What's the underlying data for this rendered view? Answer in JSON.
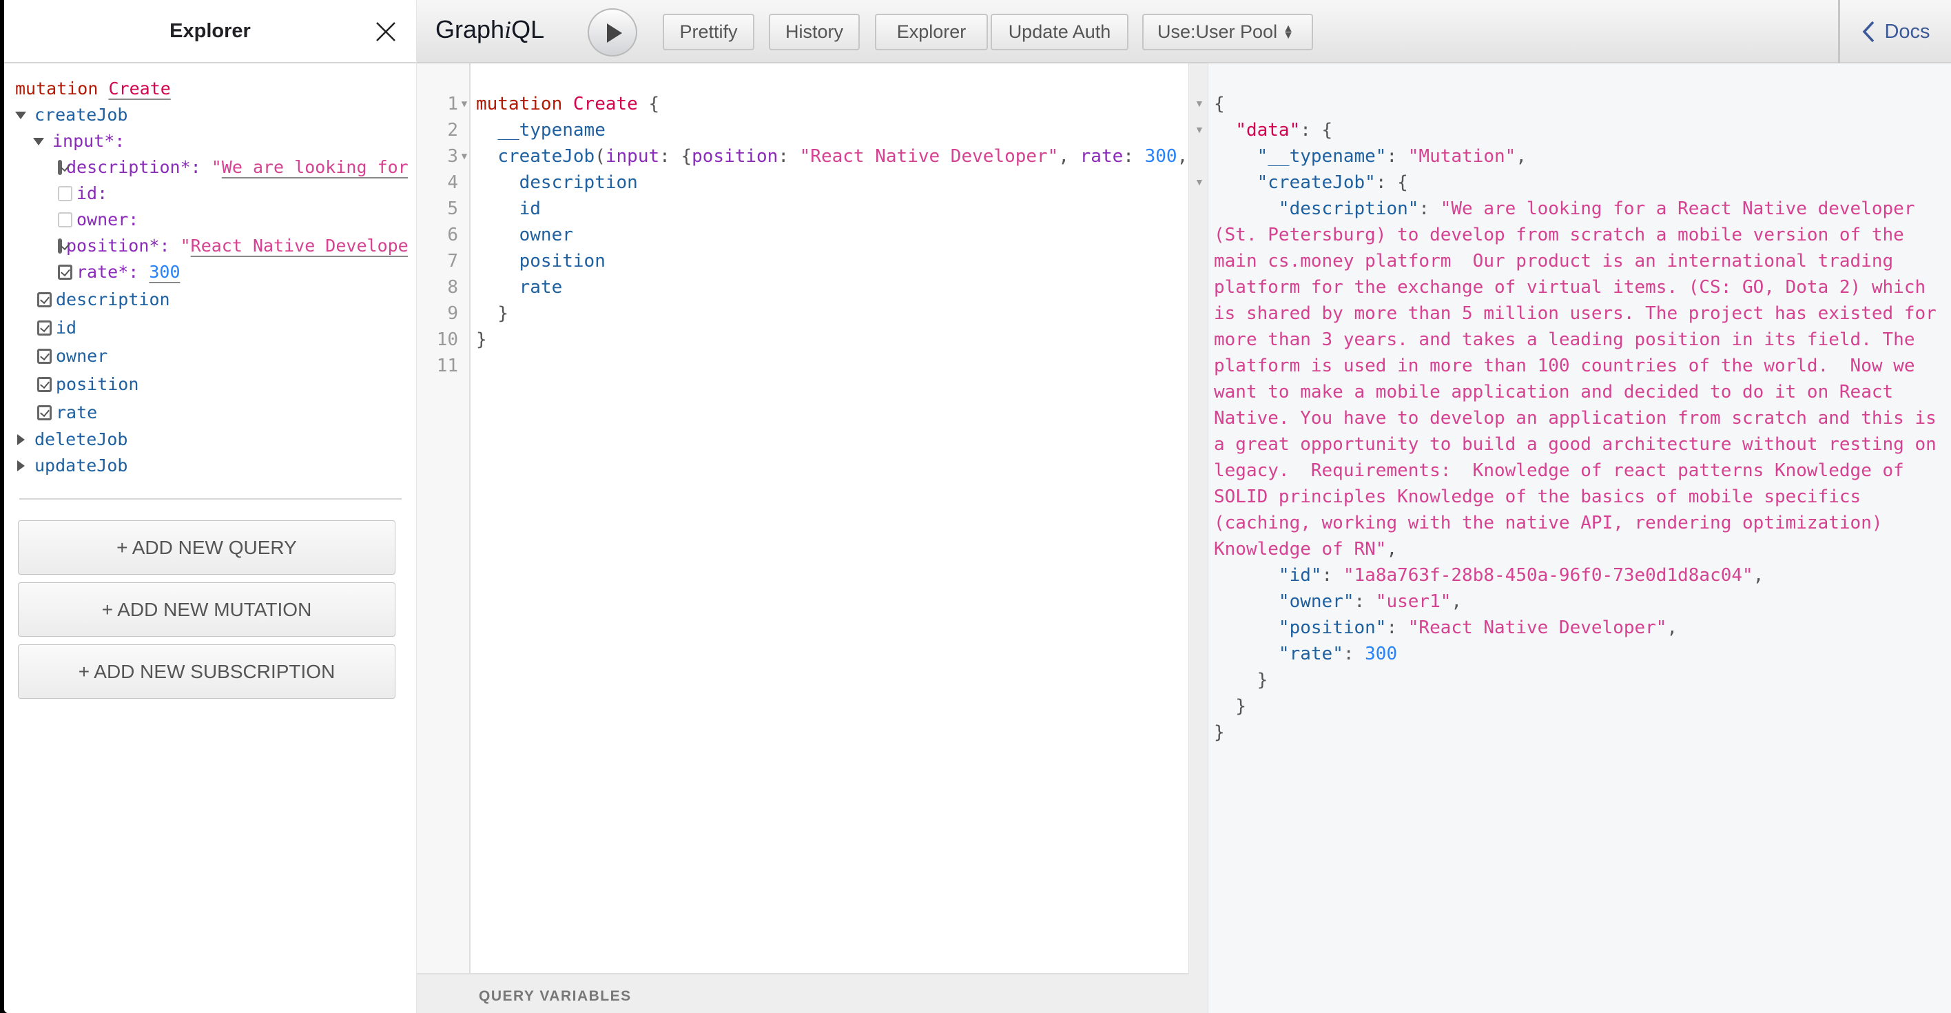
{
  "explorer": {
    "title": "Explorer",
    "operation": {
      "keyword": "mutation",
      "name": "Create"
    },
    "tree": {
      "createJob": {
        "label": "createJob",
        "input": {
          "label": "input*:",
          "fields": [
            {
              "label": "description*:",
              "checked": true,
              "value_prefix": "\"",
              "value": "We are looking for"
            },
            {
              "label": "id:",
              "checked": false
            },
            {
              "label": "owner:",
              "checked": false
            },
            {
              "label": "position*:",
              "checked": true,
              "value_prefix": "\"",
              "value": "React Native Develope"
            },
            {
              "label": "rate*:",
              "checked": true,
              "value": "300"
            }
          ]
        },
        "selections": [
          {
            "label": "description",
            "checked": true
          },
          {
            "label": "id",
            "checked": true
          },
          {
            "label": "owner",
            "checked": true
          },
          {
            "label": "position",
            "checked": true
          },
          {
            "label": "rate",
            "checked": true
          }
        ]
      },
      "deleteJob": {
        "label": "deleteJob"
      },
      "updateJob": {
        "label": "updateJob"
      }
    },
    "buttons": {
      "add_query": "+ ADD NEW QUERY",
      "add_mutation": "+ ADD NEW MUTATION",
      "add_subscription": "+ ADD NEW SUBSCRIPTION"
    }
  },
  "toolbar": {
    "logo_prefix": "Graph",
    "logo_italic": "i",
    "logo_suffix": "QL",
    "prettify": "Prettify",
    "history": "History",
    "explorer": "Explorer",
    "update_auth": "Update Auth",
    "auth_mode": "Use:User Pool",
    "docs": "Docs"
  },
  "editor": {
    "line_numbers": [
      "1",
      "2",
      "3",
      "4",
      "5",
      "6",
      "7",
      "8",
      "9",
      "10",
      "11"
    ],
    "lines": {
      "l1": {
        "kw": "mutation",
        "name": "Create",
        "brace": "{"
      },
      "l2": {
        "field": "__typename"
      },
      "l3": {
        "field": "createJob",
        "open": "(",
        "arg": "input",
        "colon": ": ",
        "brace": "{",
        "arg2": "position",
        "colon2": ": ",
        "str": "\"React Native Developer\"",
        "comma": ", ",
        "arg3": "rate",
        "colon3": ": ",
        "num": "300",
        "comma2": ","
      },
      "l4": {
        "field": "description"
      },
      "l5": {
        "field": "id"
      },
      "l6": {
        "field": "owner"
      },
      "l7": {
        "field": "position"
      },
      "l8": {
        "field": "rate"
      },
      "l9": {
        "brace": "}"
      },
      "l10": {
        "brace": "}"
      }
    },
    "variables_label": "QUERY VARIABLES"
  },
  "result": {
    "typename_key": "\"__typename\"",
    "typename_value": "\"Mutation\"",
    "data_key": "\"data\"",
    "createJob_key": "\"createJob\"",
    "description_key": "\"description\"",
    "description_value": "\"We are looking for a React Native developer (St. Petersburg) to develop from scratch a mobile version of the main cs.money platform  Our product is an international trading platform for the exchange of virtual items. (CS: GO, Dota 2) which is shared by more than 5 million users. The project has existed for more than 3 years. and takes a leading position in its field. The platform is used in more than 100 countries of the world.  Now we want to make a mobile application and decided to do it on React Native. You have to develop an application from scratch and this is a great opportunity to build a good architecture without resting on legacy.  Requirements:  Knowledge of react patterns Knowledge of SOLID principles Knowledge of the basics of mobile specifics (caching, working with the native API, rendering optimization) Knowledge of RN\"",
    "id_key": "\"id\"",
    "id_value": "\"1a8a763f-28b8-450a-96f0-73e0d1d8ac04\"",
    "owner_key": "\"owner\"",
    "owner_value": "\"user1\"",
    "position_key": "\"position\"",
    "position_value": "\"React Native Developer\"",
    "rate_key": "\"rate\"",
    "rate_value": "300"
  }
}
